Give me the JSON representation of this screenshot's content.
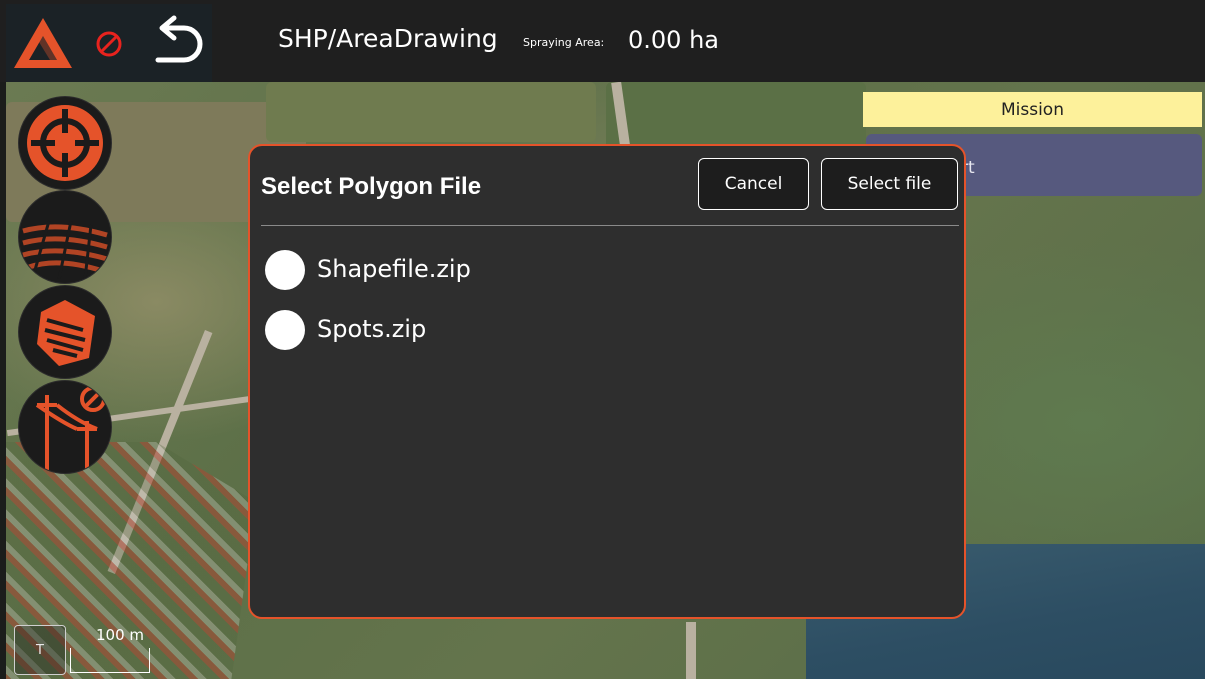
{
  "header": {
    "title": "SHP/AreaDrawing",
    "spraying_area_label": "Spraying Area:",
    "spraying_area_value": "0.00 ha"
  },
  "header_icons": [
    "logo-icon",
    "no-fly-icon",
    "back-arrow-icon"
  ],
  "tools": [
    {
      "name": "crosshair-target-icon"
    },
    {
      "name": "field-rows-icon"
    },
    {
      "name": "polygon-layers-icon"
    },
    {
      "name": "power-line-icon"
    }
  ],
  "mission": {
    "header": "Mission",
    "start_label": "rt"
  },
  "map": {
    "scale_label": "100 m",
    "scale_toggle": "T"
  },
  "dialog": {
    "title": "Select Polygon File",
    "cancel_label": "Cancel",
    "select_label": "Select file",
    "files": [
      {
        "name": "Shapefile.zip",
        "selected": false
      },
      {
        "name": "Spots.zip",
        "selected": false
      }
    ]
  },
  "colors": {
    "accent": "#e5532a",
    "mission_header": "#fdf19b",
    "mission_button": "#56597e",
    "dialog_bg": "#2e2e2e"
  }
}
